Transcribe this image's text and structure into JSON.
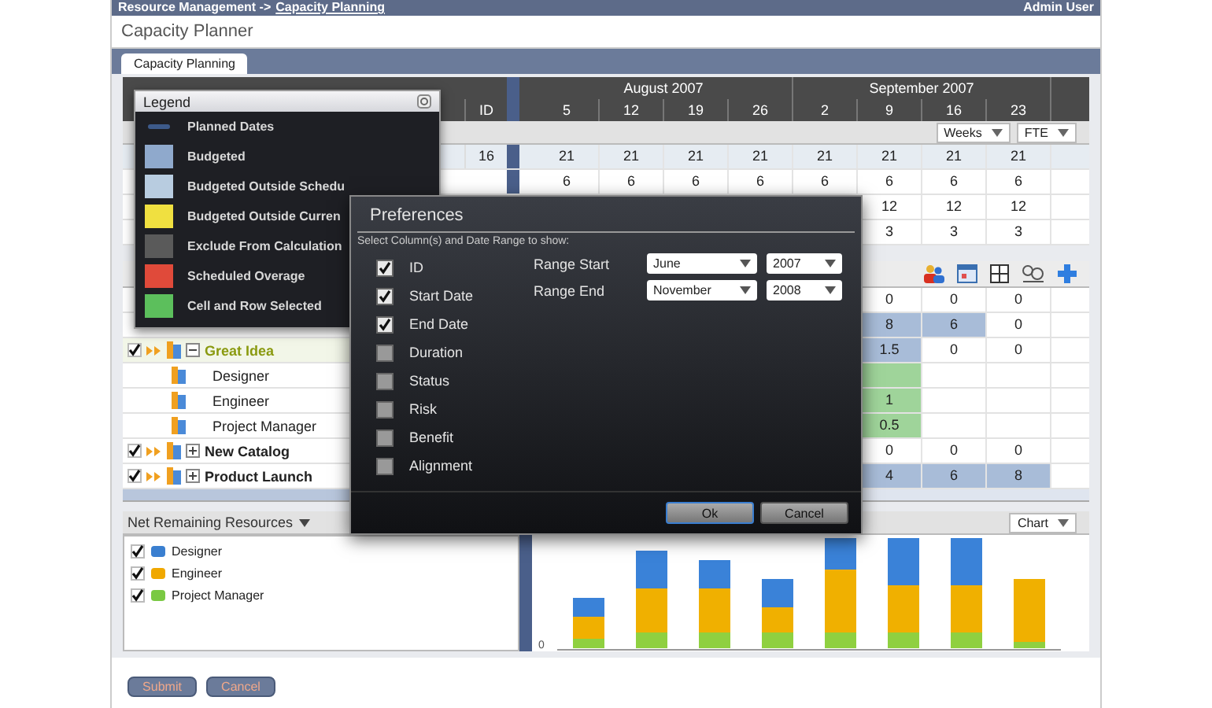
{
  "header": {
    "breadcrumb": "Resource Management ->",
    "link": "Capacity Planning",
    "user": "Admin User"
  },
  "page_title": "Capacity Planner",
  "tabs": [
    {
      "label": "Capacity Planning",
      "selected": true
    }
  ],
  "timeline": {
    "id_header": "ID",
    "months": [
      {
        "label": "August 2007",
        "weeks": [
          "5",
          "12",
          "19",
          "26"
        ]
      },
      {
        "label": "September 2007",
        "weeks": [
          "2",
          "9",
          "16",
          "23"
        ]
      }
    ]
  },
  "top_grid": {
    "unit": "Weeks",
    "measure": "FTE",
    "rows": [
      {
        "id": "16",
        "values": [
          "21",
          "21",
          "21",
          "21",
          "21",
          "21",
          "21",
          "21"
        ]
      },
      {
        "values": [
          "6",
          "6",
          "6",
          "6",
          "6",
          "6",
          "6",
          "6"
        ]
      },
      {
        "values": [
          "12",
          "12",
          "12"
        ]
      },
      {
        "values": [
          "3",
          "3",
          "3"
        ]
      }
    ]
  },
  "plan_grid": {
    "rows": [
      {
        "cells": [
          {
            "value": "0",
            "kind": "plain"
          },
          {
            "value": "0",
            "kind": "plain"
          },
          {
            "value": "0",
            "kind": "plain"
          }
        ]
      },
      {
        "cells": [
          {
            "value": "8",
            "kind": "budgeted"
          },
          {
            "value": "6",
            "kind": "budgeted"
          },
          {
            "value": "0",
            "kind": "plain"
          }
        ]
      },
      {
        "name": "Great Idea",
        "kind": "project",
        "checked": true,
        "expanded": true,
        "selected": true,
        "cells": [
          {
            "value": "1.5",
            "kind": "budgeted"
          },
          {
            "value": "0",
            "kind": "plain"
          },
          {
            "value": "0",
            "kind": "plain"
          }
        ]
      },
      {
        "name": "Designer",
        "kind": "role",
        "cells": [
          {
            "kind": "selected"
          },
          {
            "kind": "plain"
          },
          {
            "kind": "plain"
          }
        ]
      },
      {
        "name": "Engineer",
        "kind": "role",
        "cells": [
          {
            "value": "1",
            "kind": "selected"
          },
          {
            "kind": "plain"
          },
          {
            "kind": "plain"
          }
        ]
      },
      {
        "name": "Project Manager",
        "kind": "role",
        "cells": [
          {
            "value": "0.5",
            "kind": "selected"
          },
          {
            "kind": "plain"
          },
          {
            "kind": "plain"
          }
        ]
      },
      {
        "name": "New Catalog",
        "kind": "project",
        "checked": true,
        "expanded": false,
        "selected": false,
        "cells": [
          {
            "value": "0",
            "kind": "plain"
          },
          {
            "value": "0",
            "kind": "plain"
          },
          {
            "value": "0",
            "kind": "plain"
          }
        ]
      },
      {
        "name": "Product Launch",
        "kind": "project",
        "checked": true,
        "expanded": false,
        "selected": false,
        "cells": [
          {
            "value": "4",
            "kind": "budgeted"
          },
          {
            "value": "6",
            "kind": "budgeted"
          },
          {
            "value": "8",
            "kind": "budgeted"
          }
        ]
      }
    ]
  },
  "legend": {
    "title": "Legend",
    "items": [
      {
        "label": "Planned Dates",
        "kind": "line",
        "color": "#3d5a8a"
      },
      {
        "label": "Budgeted",
        "kind": "swatch",
        "color": "#8fa9cc"
      },
      {
        "label": "Budgeted Outside Schedu",
        "kind": "swatch",
        "color": "#b8cce0"
      },
      {
        "label": "Budgeted Outside Curren",
        "kind": "swatch",
        "color": "#f0e040"
      },
      {
        "label": "Exclude From Calculation",
        "kind": "swatch",
        "color": "#5a5a5a"
      },
      {
        "label": "Scheduled Overage",
        "kind": "swatch",
        "color": "#e04a3a"
      },
      {
        "label": "Cell and Row Selected",
        "kind": "swatch",
        "color": "#5cbf5c"
      }
    ]
  },
  "preferences": {
    "title": "Preferences",
    "instruction": "Select Column(s) and Date Range to show:",
    "columns": [
      {
        "label": "ID",
        "checked": true
      },
      {
        "label": "Start Date",
        "checked": true
      },
      {
        "label": "End Date",
        "checked": true
      },
      {
        "label": "Duration",
        "checked": false
      },
      {
        "label": "Status",
        "checked": false
      },
      {
        "label": "Risk",
        "checked": false
      },
      {
        "label": "Benefit",
        "checked": false
      },
      {
        "label": "Alignment",
        "checked": false
      }
    ],
    "ranges": [
      {
        "label": "Range Start",
        "month": "June",
        "year": "2007"
      },
      {
        "label": "Range End",
        "month": "November",
        "year": "2008"
      }
    ],
    "buttons": [
      {
        "label": "Ok",
        "primary": true
      },
      {
        "label": "Cancel",
        "primary": false
      }
    ]
  },
  "resources": {
    "view": "Net Remaining Resources",
    "chart_mode": "Chart",
    "axis_label": "0",
    "items": [
      {
        "label": "Designer",
        "checked": true,
        "color": "#3a7fd0"
      },
      {
        "label": "Engineer",
        "checked": true,
        "color": "#f0a800"
      },
      {
        "label": "Project Manager",
        "checked": true,
        "color": "#7ac943"
      }
    ]
  },
  "footer_buttons": [
    "Submit",
    "Cancel"
  ]
}
